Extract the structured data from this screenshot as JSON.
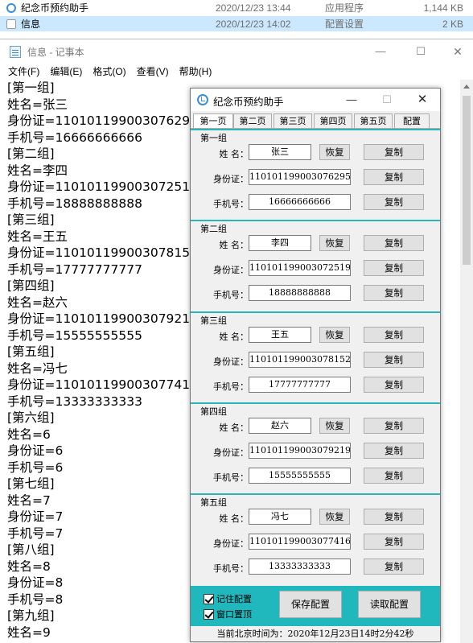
{
  "explorer": {
    "files": [
      {
        "name": "纪念币预约助手",
        "date": "2020/12/23 13:44",
        "type": "应用程序",
        "size": "1,144 KB",
        "icon": "app-icon"
      },
      {
        "name": "信息",
        "date": "2020/12/23 14:02",
        "type": "配置设置",
        "size": "2 KB",
        "icon": "gear-file-icon"
      }
    ]
  },
  "notepad": {
    "title": "信息 - 记事本",
    "controls": {
      "minimize": "—",
      "maximize": "☐",
      "close": "✕"
    },
    "menu": [
      "文件(F)",
      "编辑(E)",
      "格式(O)",
      "查看(V)",
      "帮助(H)"
    ],
    "lines": [
      "[第一组]",
      "姓名=张三",
      "身份证=110101199003076295",
      "手机号=16666666666",
      "[第二组]",
      "姓名=李四",
      "身份证=110101199003072519",
      "手机号=18888888888",
      "[第三组]",
      "姓名=王五",
      "身份证=110101199003078152",
      "手机号=17777777777",
      "[第四组]",
      "姓名=赵六",
      "身份证=110101199003079219",
      "手机号=15555555555",
      "[第五组]",
      "姓名=冯七",
      "身份证=110101199003077416",
      "手机号=13333333333",
      "[第六组]",
      "姓名=6",
      "身份证=6",
      "手机号=6",
      "[第七组]",
      "姓名=7",
      "身份证=7",
      "手机号=7",
      "[第八组]",
      "姓名=8",
      "身份证=8",
      "手机号=8",
      "[第九组]",
      "姓名=9"
    ]
  },
  "app": {
    "title": "纪念币预约助手",
    "controls": {
      "minimize": "—",
      "maximize": "☐",
      "close": "✕"
    },
    "tabs": [
      "第一页",
      "第二页",
      "第三页",
      "第四页",
      "第五页",
      "配置"
    ],
    "active_tab": "第一页",
    "field_labels": {
      "name": "姓  名：",
      "id": "身份证：",
      "phone": "手机号："
    },
    "restore_label": "恢复",
    "copy_label": "复制",
    "groups": [
      {
        "label": "第一组",
        "name": "张三",
        "id": "110101199003076295",
        "phone": "16666666666"
      },
      {
        "label": "第二组",
        "name": "李四",
        "id": "110101199003072519",
        "phone": "18888888888"
      },
      {
        "label": "第三组",
        "name": "王五",
        "id": "110101199003078152",
        "phone": "17777777777"
      },
      {
        "label": "第四组",
        "name": "赵六",
        "id": "110101199003079219",
        "phone": "15555555555"
      },
      {
        "label": "第五组",
        "name": "冯七",
        "id": "110101199003077416",
        "phone": "13333333333"
      }
    ],
    "options": {
      "remember": "记住配置",
      "topmost": "窗口置顶"
    },
    "save_label": "保存配置",
    "load_label": "读取配置",
    "status": "当前北京时间为：2020年12月23日14时2分42秒",
    "colors": {
      "accent": "#20b8bc",
      "separator": "#2ab6b8"
    }
  }
}
